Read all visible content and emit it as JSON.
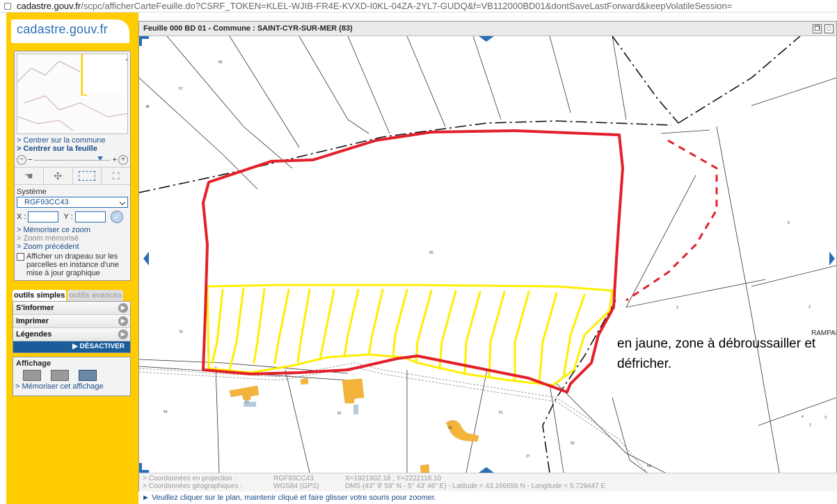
{
  "browser": {
    "url_host": "cadastre.gouv.fr",
    "url_rest": "/scpc/afficherCarteFeuille.do?CSRF_TOKEN=KLEL-WJIB-FR4E-KVXD-I0KL-04ZA-2YL7-GUDQ&f=VB112000BD01&dontSaveLastForward&keepVolatileSession="
  },
  "site": {
    "logo": "cadastre.gouv.fr"
  },
  "sidebar": {
    "links": {
      "center_commune": "> Centrer sur la commune",
      "center_feuille": "> Centrer sur la feuille"
    },
    "systeme_label": "Système",
    "systeme_value": "RGF93CC43",
    "x_label": "X :",
    "y_label": "Y :",
    "zoom_links": {
      "memorize": "> Mémoriser ce zoom",
      "memorized": "> Zoom mémorisé",
      "previous": "> Zoom précédent"
    },
    "checkbox_text": "Afficher un drapeau sur les parcelles en instance d'une mise à jour graphique"
  },
  "tabs": {
    "simple": "outils simples",
    "advanced": "outils avancés"
  },
  "menu": {
    "items": [
      "S'informer",
      "Imprimer",
      "Légendes"
    ],
    "deactivate": "DÉSACTIVER"
  },
  "affichage": {
    "title": "Affichage",
    "memorize": "> Mémoriser cet affichage"
  },
  "map": {
    "title": "Feuille 000 BD 01 - Commune : SAINT-CYR-SUR-MER (83)",
    "parcels": [
      "56",
      "57",
      "38",
      "65",
      "70",
      "54",
      "53",
      "52",
      "50",
      "51",
      "53",
      "27",
      "54",
      "9",
      "2",
      "3",
      "4",
      "2",
      "3"
    ],
    "place_label": "RAMPALI",
    "annotation": "en jaune, zone à débroussailler et défricher."
  },
  "footer": {
    "proj_label": "> Coordonnées en projection :",
    "proj_system": "RGF93CC43",
    "proj_values": "X=1921902.18 ; Y=2222118.10",
    "geo_label": "> Coordonnées géographiques :",
    "geo_system": "WGS84 (GPS)",
    "geo_values": "DMS (43° 9' 59\" N - 5° 43' 46\" E) - Latitude = 43.166656 N - Longitude = 5.729447 E",
    "hint": "► Veuillez cliquer sur le plan, maintenir cliqué et faire glisser votre souris pour zoomer."
  },
  "colors": {
    "accent_yellow": "#ffcc00",
    "brand_blue": "#1a5d9b",
    "outline_red": "#e3202a",
    "zone_yellow": "#ffee00"
  }
}
